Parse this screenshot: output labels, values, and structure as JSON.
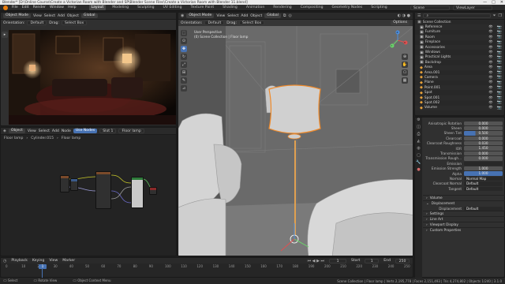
{
  "window": {
    "title": "Blender* [D:\\Online Course\\Create a Victorian Room with Blender and SP\\Blender Scene Files\\Create a Victorian Room with Blender 11.blend]",
    "controls": [
      "—",
      "□",
      "✕"
    ]
  },
  "menubar": {
    "menus": [
      "File",
      "Edit",
      "Render",
      "Window",
      "Help"
    ],
    "workspaces": [
      "Layout",
      "Modeling",
      "Sculpting",
      "UV Editing",
      "Texture Paint",
      "Shading",
      "Animation",
      "Rendering",
      "Compositing",
      "Geometry Nodes",
      "Scripting"
    ],
    "active_workspace": "Layout",
    "scene_label": "Scene",
    "view_layer_label": "ViewLayer"
  },
  "render_view": {
    "header": [
      "Orientation:",
      "Default",
      "Drag:",
      "Select Box"
    ],
    "mode": "Object Mode",
    "menus": [
      "View",
      "Select",
      "Add",
      "Object"
    ],
    "transform": "Global"
  },
  "shader_editor": {
    "header": [
      "Object",
      "View",
      "Select",
      "Add",
      "Node",
      "Use Nodes",
      "Slot 1",
      "Floor lamp"
    ],
    "breadcrumb": [
      "Floor lamp",
      "Cylinder.015",
      "Floor lamp"
    ]
  },
  "viewport": {
    "header": [
      "Orientation:",
      "Default",
      "Drag:",
      "Select Box"
    ],
    "mode": "Object Mode",
    "menus": [
      "View",
      "Select",
      "Add",
      "Object"
    ],
    "transform": "Global",
    "options_label": "Options",
    "info_line1": "User Perspective",
    "info_line2": "(0) Scene Collection | Floor lamp",
    "axes": [
      "X",
      "Y",
      "Z"
    ]
  },
  "outliner": {
    "search_placeholder": "",
    "root": "Scene Collection",
    "items": [
      {
        "name": "Reference",
        "color": "#c7c7c7"
      },
      {
        "name": "Furniture",
        "color": "#c7c7c7"
      },
      {
        "name": "Room",
        "color": "#c7c7c7"
      },
      {
        "name": "Fireplace",
        "color": "#c7c7c7"
      },
      {
        "name": "Accessories",
        "color": "#c7c7c7"
      },
      {
        "name": "Windows",
        "color": "#c7c7c7"
      },
      {
        "name": "Practical Lights",
        "color": "#c7c7c7"
      },
      {
        "name": "Backdrop",
        "color": "#c7c7c7"
      },
      {
        "name": "Area",
        "color": "#e8a23a"
      },
      {
        "name": "Area.001",
        "color": "#e8a23a"
      },
      {
        "name": "Camera",
        "color": "#e8a23a"
      },
      {
        "name": "Plane",
        "color": "#e8a23a"
      },
      {
        "name": "Point.001",
        "color": "#e8a23a"
      },
      {
        "name": "Spot",
        "color": "#e8a23a"
      },
      {
        "name": "Spot.001",
        "color": "#e8a23a"
      },
      {
        "name": "Spot.002",
        "color": "#e8a23a"
      },
      {
        "name": "Volume",
        "color": "#e8a23a"
      }
    ]
  },
  "properties": {
    "rows": [
      {
        "label": "Anisotropic Rotation",
        "value": "0.000"
      },
      {
        "label": "Sheen",
        "value": "0.000"
      },
      {
        "label": "Sheen Tint",
        "value": "0.500",
        "style": "fill"
      },
      {
        "label": "Clearcoat",
        "value": "0.000"
      },
      {
        "label": "Clearcoat Roughness",
        "value": "0.030"
      },
      {
        "label": "IOR",
        "value": "1.450"
      },
      {
        "label": "Transmission",
        "value": "0.000"
      },
      {
        "label": "Transmission Rough...",
        "value": "0.000"
      },
      {
        "label": "Emission",
        "value": "",
        "style": "dark"
      },
      {
        "label": "Emission Strength",
        "value": "1.000"
      },
      {
        "label": "Alpha",
        "value": "1.000",
        "style": "blue"
      },
      {
        "label": "Normal",
        "value": "Normal Map",
        "style": "dark"
      },
      {
        "label": "Clearcoat Normal",
        "value": "Default",
        "style": "dark"
      },
      {
        "label": "Tangent",
        "value": "Default",
        "style": "dark"
      }
    ],
    "volume_label": "Volume",
    "displacement_label": "Displacement",
    "displacement_row": {
      "label": "Displacement",
      "value": "Default"
    },
    "sections": [
      "Settings",
      "Line Art",
      "Viewport Display",
      "Custom Properties"
    ]
  },
  "timeline": {
    "menus": [
      "Playback",
      "Keying",
      "View",
      "Marker"
    ],
    "current_frame": "1",
    "start_label": "Start",
    "start": "1",
    "end_label": "End",
    "end": "250",
    "ticks": [
      "0",
      "10",
      "20",
      "30",
      "40",
      "50",
      "60",
      "70",
      "80",
      "90",
      "100",
      "110",
      "120",
      "130",
      "140",
      "150",
      "160",
      "170",
      "180",
      "190",
      "200",
      "210",
      "220",
      "230",
      "240",
      "250"
    ]
  },
  "statusbar": {
    "select": "Select",
    "rotate": "Rotate View",
    "context": "Object Context Menu",
    "stats": "Scene Collection | Floor lamp | Verts 2,195,778 | Faces 2,151,493 | Tris 4,274,802 | Objects 1/240 | 3.1.0"
  }
}
